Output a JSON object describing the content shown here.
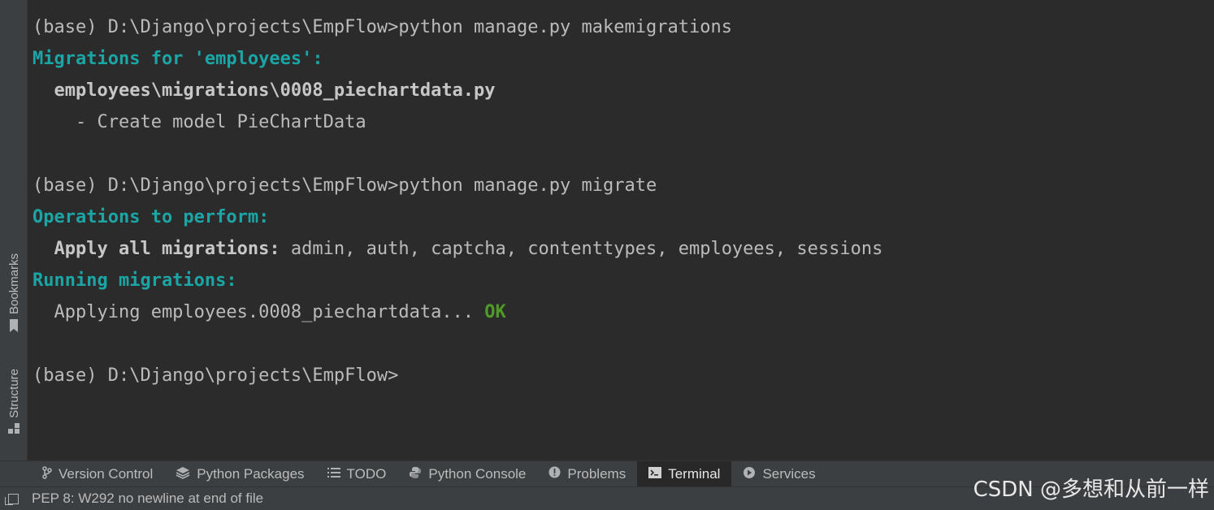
{
  "left_rail": {
    "bookmarks_label": "Bookmarks",
    "structure_label": "Structure"
  },
  "terminal": {
    "line1": "(base) D:\\Django\\projects\\EmpFlow>python manage.py makemigrations",
    "line2": "Migrations for 'employees':",
    "line3": "  employees\\migrations\\0008_piechartdata.py",
    "line4": "    - Create model PieChartData",
    "line6": "(base) D:\\Django\\projects\\EmpFlow>python manage.py migrate",
    "line7": "Operations to perform:",
    "line8_prefix": "  Apply all migrations:",
    "line8_rest": " admin, auth, captcha, contenttypes, employees, sessions",
    "line9": "Running migrations:",
    "line10_prefix": "  Applying employees.0008_piechartdata...",
    "line10_ok": " OK",
    "line12": "(base) D:\\Django\\projects\\EmpFlow>"
  },
  "tool_tabs": {
    "version_control": "Version Control",
    "python_packages": "Python Packages",
    "todo": "TODO",
    "python_console": "Python Console",
    "problems": "Problems",
    "terminal": "Terminal",
    "services": "Services"
  },
  "status_bar": {
    "message": "PEP 8: W292 no newline at end of file"
  },
  "watermark": "CSDN @多想和从前一样",
  "colors": {
    "terminal_bg": "#2b2b2b",
    "accent_teal": "#1ba5a5",
    "ok_green": "#4e9b2a"
  }
}
